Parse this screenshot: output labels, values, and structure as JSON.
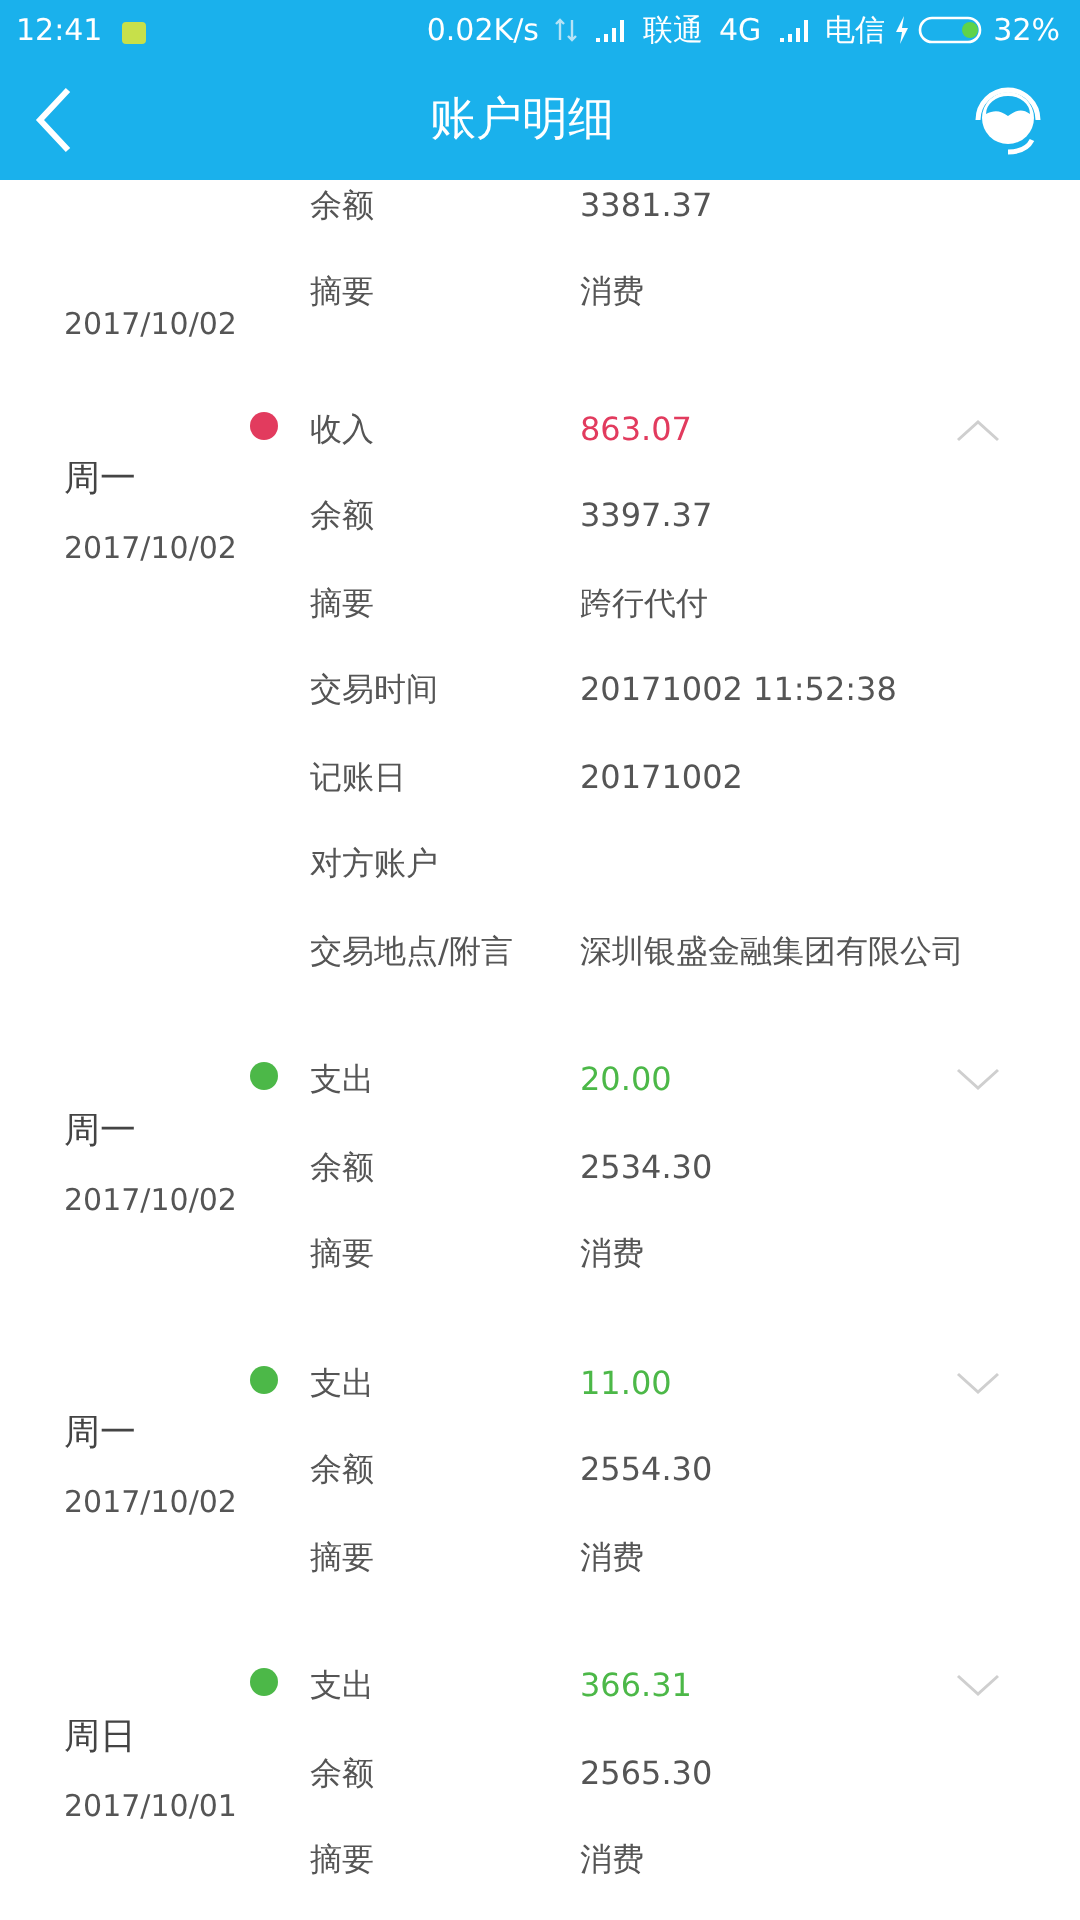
{
  "status_bar": {
    "time": "12:41",
    "speed": "0.02K/s",
    "carrier_1": "联通",
    "network_1": "4G",
    "carrier_2": "电信",
    "battery": "32%"
  },
  "header": {
    "title": "账户明细"
  },
  "entries": [
    {
      "date": "2017/10/02",
      "rows": [
        {
          "label": "余额",
          "value": "3381.37"
        },
        {
          "label": "摘要",
          "value": "消费"
        }
      ]
    },
    {
      "weekday": "周一",
      "date": "2017/10/02",
      "type": "收入",
      "amount": "863.07",
      "color": "#e23b5e",
      "expanded": true,
      "rows": [
        {
          "label": "余额",
          "value": "3397.37"
        },
        {
          "label": "摘要",
          "value": "跨行代付"
        },
        {
          "label": "交易时间",
          "value": "20171002 11:52:38"
        },
        {
          "label": "记账日",
          "value": "20171002"
        },
        {
          "label": "对方账户"
        },
        {
          "label": "交易地点/附言",
          "value": "深圳银盛金融集团有限公司"
        }
      ]
    },
    {
      "weekday": "周一",
      "date": "2017/10/02",
      "type": "支出",
      "amount": "20.00",
      "color": "#4cb848",
      "expanded": false,
      "rows": [
        {
          "label": "余额",
          "value": "2534.30"
        },
        {
          "label": "摘要",
          "value": "消费"
        }
      ]
    },
    {
      "weekday": "周一",
      "date": "2017/10/02",
      "type": "支出",
      "amount": "11.00",
      "color": "#4cb848",
      "expanded": false,
      "rows": [
        {
          "label": "余额",
          "value": "2554.30"
        },
        {
          "label": "摘要",
          "value": "消费"
        }
      ]
    },
    {
      "weekday": "周日",
      "date": "2017/10/01",
      "type": "支出",
      "amount": "366.31",
      "color": "#4cb848",
      "expanded": false,
      "rows": [
        {
          "label": "余额",
          "value": "2565.30"
        },
        {
          "label": "摘要",
          "value": "消费"
        }
      ]
    }
  ]
}
